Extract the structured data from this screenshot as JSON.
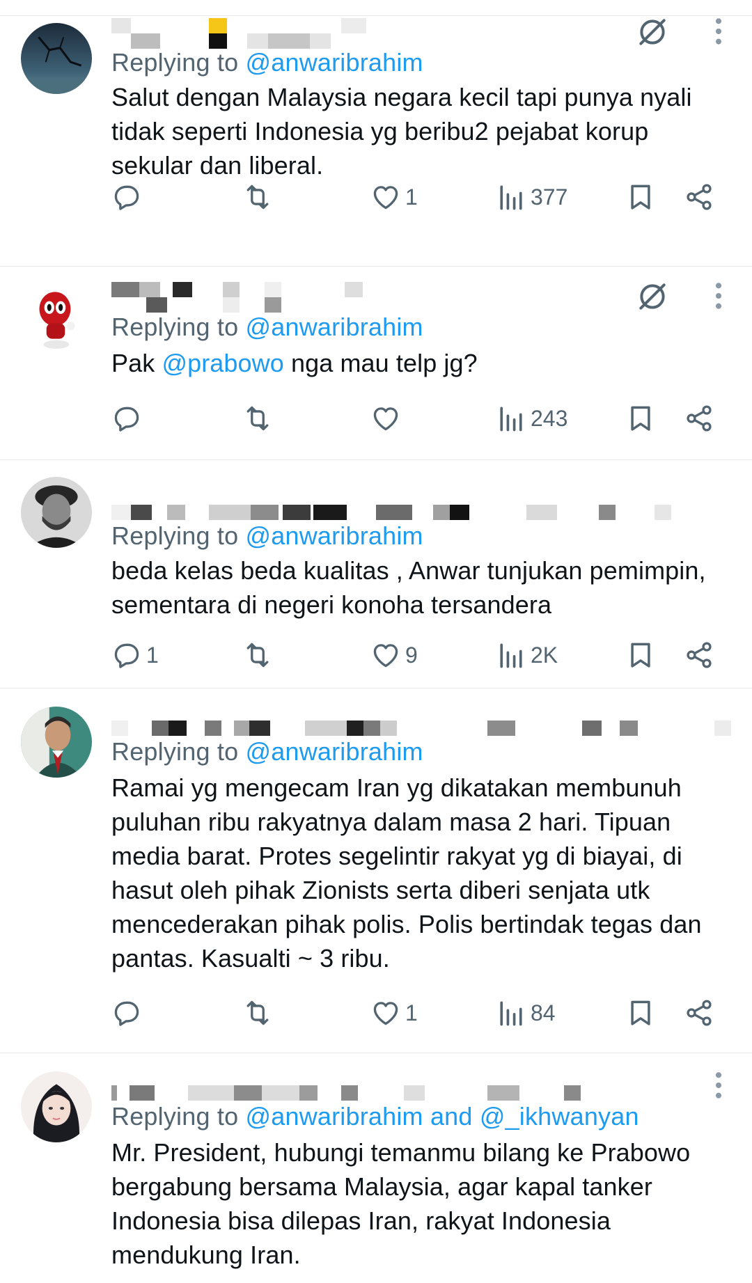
{
  "icons": {
    "reply": "speech-bubble-icon",
    "repost": "repost-arrows-icon",
    "like": "heart-icon",
    "views": "bar-chart-icon",
    "bookmark": "bookmark-icon",
    "share": "share-icon",
    "ghost": "ghost-circle-slash-icon",
    "more": "vertical-dots-icon"
  },
  "colors": {
    "text": "#0f1419",
    "muted": "#536471",
    "accent": "#1d9bf0",
    "divider": "#e6e9ec"
  },
  "replies": [
    {
      "replying_prefix": "Replying to ",
      "replying_to": "@anwaribrahim",
      "text": "Salut dengan Malaysia negara kecil tapi punya nyali tidak seperti Indonesia yg beribu2 pejabat korup sekular dan liberal.",
      "reply_count": "",
      "likes": "1",
      "views": "377"
    },
    {
      "replying_prefix": "Replying to ",
      "replying_to": "@anwaribrahim",
      "text_before": "Pak ",
      "text_mention": "@prabowo",
      "text_after": " nga mau telp jg?",
      "reply_count": "",
      "likes": "",
      "views": "243"
    },
    {
      "replying_prefix": "Replying to ",
      "replying_to": "@anwaribrahim",
      "text": "beda kelas beda kualitas , Anwar tunjukan pemimpin, sementara di negeri konoha tersandera",
      "reply_count": "1",
      "likes": "9",
      "views": "2K"
    },
    {
      "replying_prefix": "Replying to ",
      "replying_to": "@anwaribrahim",
      "text": "Ramai yg mengecam Iran yg dikatakan membunuh puluhan ribu rakyatnya dalam masa 2 hari. Tipuan media barat. Protes segelintir rakyat yg di biayai, di hasut oleh pihak Zionists serta diberi senjata utk mencederakan pihak polis. Polis bertindak tegas dan pantas. Kasualti ~ 3 ribu.",
      "reply_count": "",
      "likes": "1",
      "views": "84"
    },
    {
      "replying_prefix": "Replying to ",
      "replying_to": "@anwaribrahim and @_ikhwanyan",
      "text": "Mr. President, hubungi temanmu bilang ke Prabowo bergabung bersama Malaysia, agar kapal tanker Indonesia bisa dilepas Iran, rakyat Indonesia mendukung Iran."
    }
  ]
}
